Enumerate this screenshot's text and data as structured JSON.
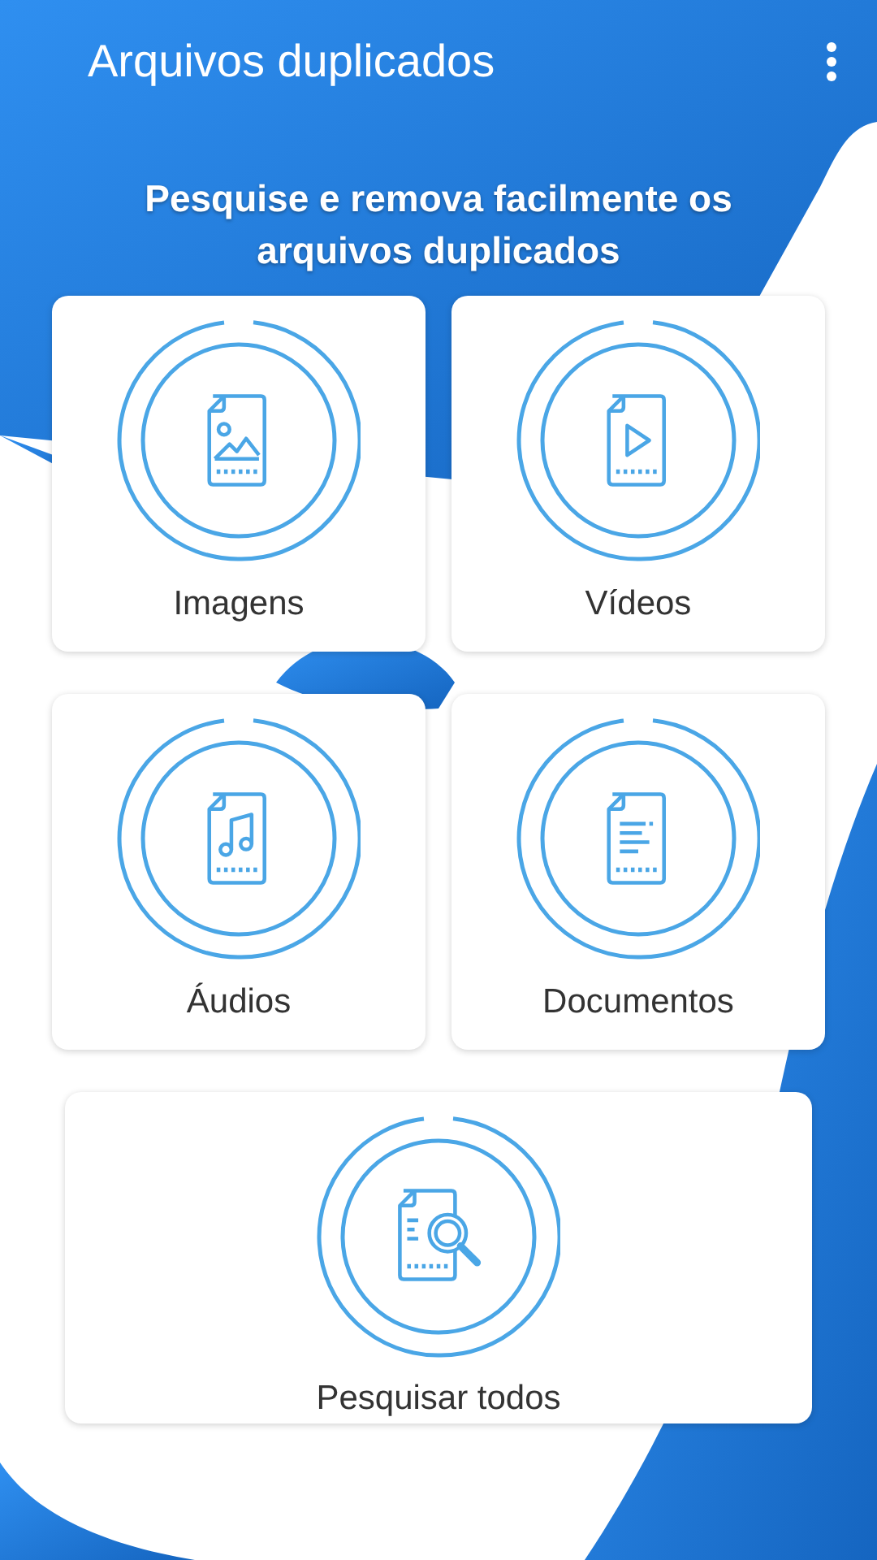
{
  "app_bar": {
    "title": "Arquivos duplicados"
  },
  "headline": "Pesquise e remova facilmente os arquivos duplicados",
  "cards": [
    {
      "kind": "image",
      "label": "Imagens"
    },
    {
      "kind": "video",
      "label": "Vídeos"
    },
    {
      "kind": "audio",
      "label": "Áudios"
    },
    {
      "kind": "document",
      "label": "Documentos"
    }
  ],
  "search_all": {
    "kind": "search",
    "label": "Pesquisar todos"
  }
}
